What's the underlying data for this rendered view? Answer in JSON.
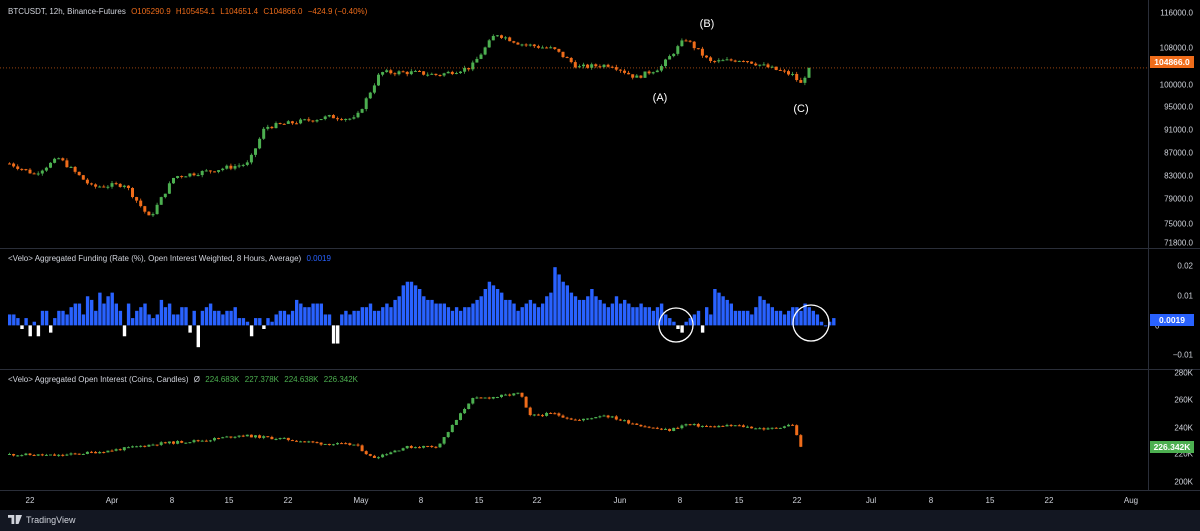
{
  "legend_price": {
    "symbol": "BTCUSDT, 12h, Binance-Futures",
    "o": "O105290.9",
    "h": "H105454.1",
    "l": "L104651.4",
    "c": "C104866.0",
    "chg": "−424.9 (−0.40%)"
  },
  "legend_funding": {
    "name": "<Velo> Aggregated Funding (Rate (%), Open Interest Weighted, 8 Hours, Average)",
    "value": "0.0019"
  },
  "legend_oi": {
    "name": "<Velo> Aggregated Open Interest (Coins, Candles)",
    "symbol": "Ø",
    "v1": "224.683K",
    "v2": "227.378K",
    "v3": "224.638K",
    "v4": "226.342K"
  },
  "price_axis": [
    "116000.0",
    "108000.0",
    "100000.0",
    "95000.0",
    "91000.0",
    "87000.0",
    "83000.0",
    "79000.0",
    "75000.0",
    "71800.0"
  ],
  "price_badge": "104866.0",
  "funding_axis": [
    "0.02",
    "0.01",
    "0",
    "−0.01"
  ],
  "funding_badge": "0.0019",
  "oi_axis": [
    "280K",
    "260K",
    "240K",
    "220K",
    "200K"
  ],
  "oi_badge": "226.342K",
  "x_axis": [
    "22",
    "Apr",
    "8",
    "15",
    "22",
    "May",
    "8",
    "15",
    "22",
    "Jun",
    "8",
    "15",
    "22",
    "Jul",
    "8",
    "15",
    "22",
    "Aug"
  ],
  "wave_labels": [
    "(A)",
    "(B)",
    "(C)"
  ],
  "footer": {
    "brand": "TradingView"
  },
  "colors": {
    "up": "#26a69a",
    "green": "#4caf50",
    "down": "#ef6c1a",
    "funding_pos": "#2962ff",
    "funding_neg": "#ffffff",
    "badge_price": "#ef6c1a",
    "badge_funding": "#2962ff",
    "badge_oi": "#4caf50"
  },
  "chart_data": [
    {
      "type": "candlestick",
      "title": "BTCUSDT, 12h, Binance-Futures",
      "x": [
        "Mar 22",
        "Apr 1",
        "Apr 8",
        "Apr 15",
        "Apr 22",
        "May 1",
        "May 8",
        "May 15",
        "May 22",
        "Jun 1",
        "Jun 8",
        "Jun 15",
        "Jun 22",
        "Jul 1",
        "Jul 8",
        "Jul 15",
        "Jul 22",
        "Aug 1"
      ],
      "close_path": [
        [
          0,
          86500
        ],
        [
          3,
          84500
        ],
        [
          6,
          87500
        ],
        [
          10,
          82000
        ],
        [
          14,
          82500
        ],
        [
          17,
          76000
        ],
        [
          20,
          84000
        ],
        [
          24,
          85000
        ],
        [
          29,
          86500
        ],
        [
          31,
          93500
        ],
        [
          35,
          94500
        ],
        [
          39,
          95500
        ],
        [
          42,
          95000
        ],
        [
          45,
          104000
        ],
        [
          49,
          104000
        ],
        [
          52,
          103500
        ],
        [
          56,
          105000
        ],
        [
          59,
          111500
        ],
        [
          62,
          109500
        ],
        [
          66,
          108500
        ],
        [
          69,
          105000
        ],
        [
          73,
          105500
        ],
        [
          76,
          103000
        ],
        [
          79,
          105000
        ],
        [
          82,
          110500
        ],
        [
          85,
          106000
        ],
        [
          89,
          106500
        ],
        [
          92,
          105000
        ],
        [
          95,
          103500
        ],
        [
          96,
          101800
        ],
        [
          97,
          104866
        ]
      ],
      "ylim": [
        71800,
        116000
      ],
      "last": 104866.0
    },
    {
      "type": "bar",
      "title": "Aggregated Funding (Rate (%), Open Interest Weighted, 8 Hours, Average)",
      "values": [
        0.003,
        0.003,
        0.002,
        -0.001,
        0.002,
        -0.003,
        0.001,
        -0.003,
        0.004,
        0.004,
        -0.002,
        0.002,
        0.004,
        0.004,
        0.003,
        0.005,
        0.006,
        0.006,
        0.003,
        0.008,
        0.007,
        0.004,
        0.009,
        0.006,
        0.008,
        0.009,
        0.006,
        0.004,
        -0.003,
        0.006,
        0.002,
        0.004,
        0.005,
        0.006,
        0.003,
        0.002,
        0.003,
        0.007,
        0.005,
        0.006,
        0.003,
        0.003,
        0.005,
        0.005,
        -0.002,
        0.004,
        -0.006,
        0.004,
        0.005,
        0.006,
        0.004,
        0.004,
        0.003,
        0.004,
        0.004,
        0.005,
        0.002,
        0.002,
        0.001,
        -0.003,
        0.002,
        0.002,
        -0.001,
        0.002,
        0.001,
        0.003,
        0.004,
        0.004,
        0.003,
        0.004,
        0.007,
        0.006,
        0.005,
        0.005,
        0.006,
        0.006,
        0.006,
        0.003,
        0.003,
        -0.005,
        -0.005,
        0.003,
        0.004,
        0.003,
        0.004,
        0.004,
        0.005,
        0.005,
        0.006,
        0.004,
        0.004,
        0.005,
        0.006,
        0.005,
        0.007,
        0.008,
        0.011,
        0.012,
        0.012,
        0.011,
        0.01,
        0.008,
        0.007,
        0.007,
        0.006,
        0.006,
        0.006,
        0.005,
        0.004,
        0.005,
        0.004,
        0.005,
        0.005,
        0.006,
        0.007,
        0.008,
        0.01,
        0.012,
        0.011,
        0.01,
        0.009,
        0.007,
        0.007,
        0.006,
        0.004,
        0.005,
        0.006,
        0.007,
        0.006,
        0.005,
        0.006,
        0.008,
        0.009,
        0.016,
        0.014,
        0.012,
        0.011,
        0.009,
        0.008,
        0.007,
        0.007,
        0.008,
        0.01,
        0.008,
        0.007,
        0.006,
        0.005,
        0.006,
        0.008,
        0.006,
        0.007,
        0.006,
        0.005,
        0.005,
        0.006,
        0.005,
        0.005,
        0.004,
        0.005,
        0.006,
        0.003,
        0.002,
        0.001,
        -0.001,
        -0.002,
        0.001,
        0.002,
        0.003,
        0.004,
        -0.002,
        0.005,
        0.003,
        0.01,
        0.009,
        0.008,
        0.007,
        0.006,
        0.004,
        0.004,
        0.004,
        0.004,
        0.003,
        0.005,
        0.008,
        0.007,
        0.006,
        0.005,
        0.004,
        0.004,
        0.003,
        0.004,
        0.005,
        0.005,
        0.004,
        0.006,
        0.005,
        0.004,
        0.003,
        0.001,
        0.0,
        0.001,
        0.002
      ],
      "ylim": [
        -0.012,
        0.021
      ],
      "last": 0.0019
    },
    {
      "type": "candlestick",
      "title": "Aggregated Open Interest (Coins, Candles)",
      "close_path": [
        [
          0,
          220000
        ],
        [
          6,
          219000
        ],
        [
          12,
          223000
        ],
        [
          18,
          229000
        ],
        [
          24,
          232000
        ],
        [
          28,
          236000
        ],
        [
          33,
          233000
        ],
        [
          38,
          229000
        ],
        [
          42,
          228000
        ],
        [
          44,
          217000
        ],
        [
          48,
          226000
        ],
        [
          52,
          227000
        ],
        [
          56,
          266000
        ],
        [
          59,
          268000
        ],
        [
          62,
          271000
        ],
        [
          63,
          252000
        ],
        [
          66,
          254000
        ],
        [
          69,
          248000
        ],
        [
          72,
          253000
        ],
        [
          75,
          247000
        ],
        [
          78,
          242000
        ],
        [
          80,
          240000
        ],
        [
          82,
          245000
        ],
        [
          85,
          243000
        ],
        [
          88,
          244000
        ],
        [
          92,
          241000
        ],
        [
          95,
          245000
        ],
        [
          96,
          226342
        ]
      ],
      "ylim": [
        197000,
        282000
      ],
      "last": 226342
    }
  ]
}
